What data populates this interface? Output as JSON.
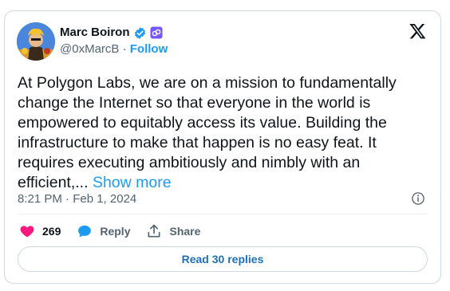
{
  "author": {
    "name": "Marc Boiron",
    "handle": "@0xMarcB",
    "separator": "·",
    "follow_label": "Follow"
  },
  "tweet": {
    "text": "At Polygon Labs, we are on a mission to fundamentally\nchange the Internet so that everyone in the world is\nempowered to equitably access its value. Building the\ninfrastructure to make that happen is no easy feat. It\nrequires executing ambitiously and nimbly with an\nefficient,...",
    "show_more": "Show more",
    "timestamp": "8:21 PM · Feb 1, 2024"
  },
  "actions": {
    "like_count": "269",
    "reply_label": "Reply",
    "share_label": "Share"
  },
  "read_replies_label": "Read 30 replies",
  "colors": {
    "accent": "#1d9bf0",
    "like": "#f91880",
    "verified": "#1d9bf0",
    "affiliate_badge": "#7856ff"
  }
}
